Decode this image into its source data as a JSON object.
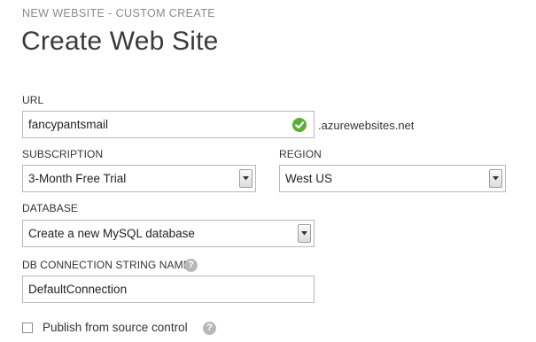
{
  "header": {
    "breadcrumb": "NEW WEBSITE - CUSTOM CREATE",
    "title": "Create Web Site"
  },
  "url": {
    "label": "URL",
    "value": "fancypantsmail",
    "suffix": ".azurewebsites.net",
    "status_icon": "check-circle-icon",
    "status_color": "#5aad36"
  },
  "subscription": {
    "label": "SUBSCRIPTION",
    "selected": "3-Month Free Trial"
  },
  "region": {
    "label": "REGION",
    "selected": "West US"
  },
  "database": {
    "label": "DATABASE",
    "selected": "Create a new MySQL database"
  },
  "db_connection": {
    "label": "DB CONNECTION STRING NAME",
    "value": "DefaultConnection",
    "help_icon": "question-icon",
    "help_glyph": "?"
  },
  "publish": {
    "label": "Publish from source control",
    "checked": false,
    "help_icon": "question-icon",
    "help_glyph": "?"
  }
}
